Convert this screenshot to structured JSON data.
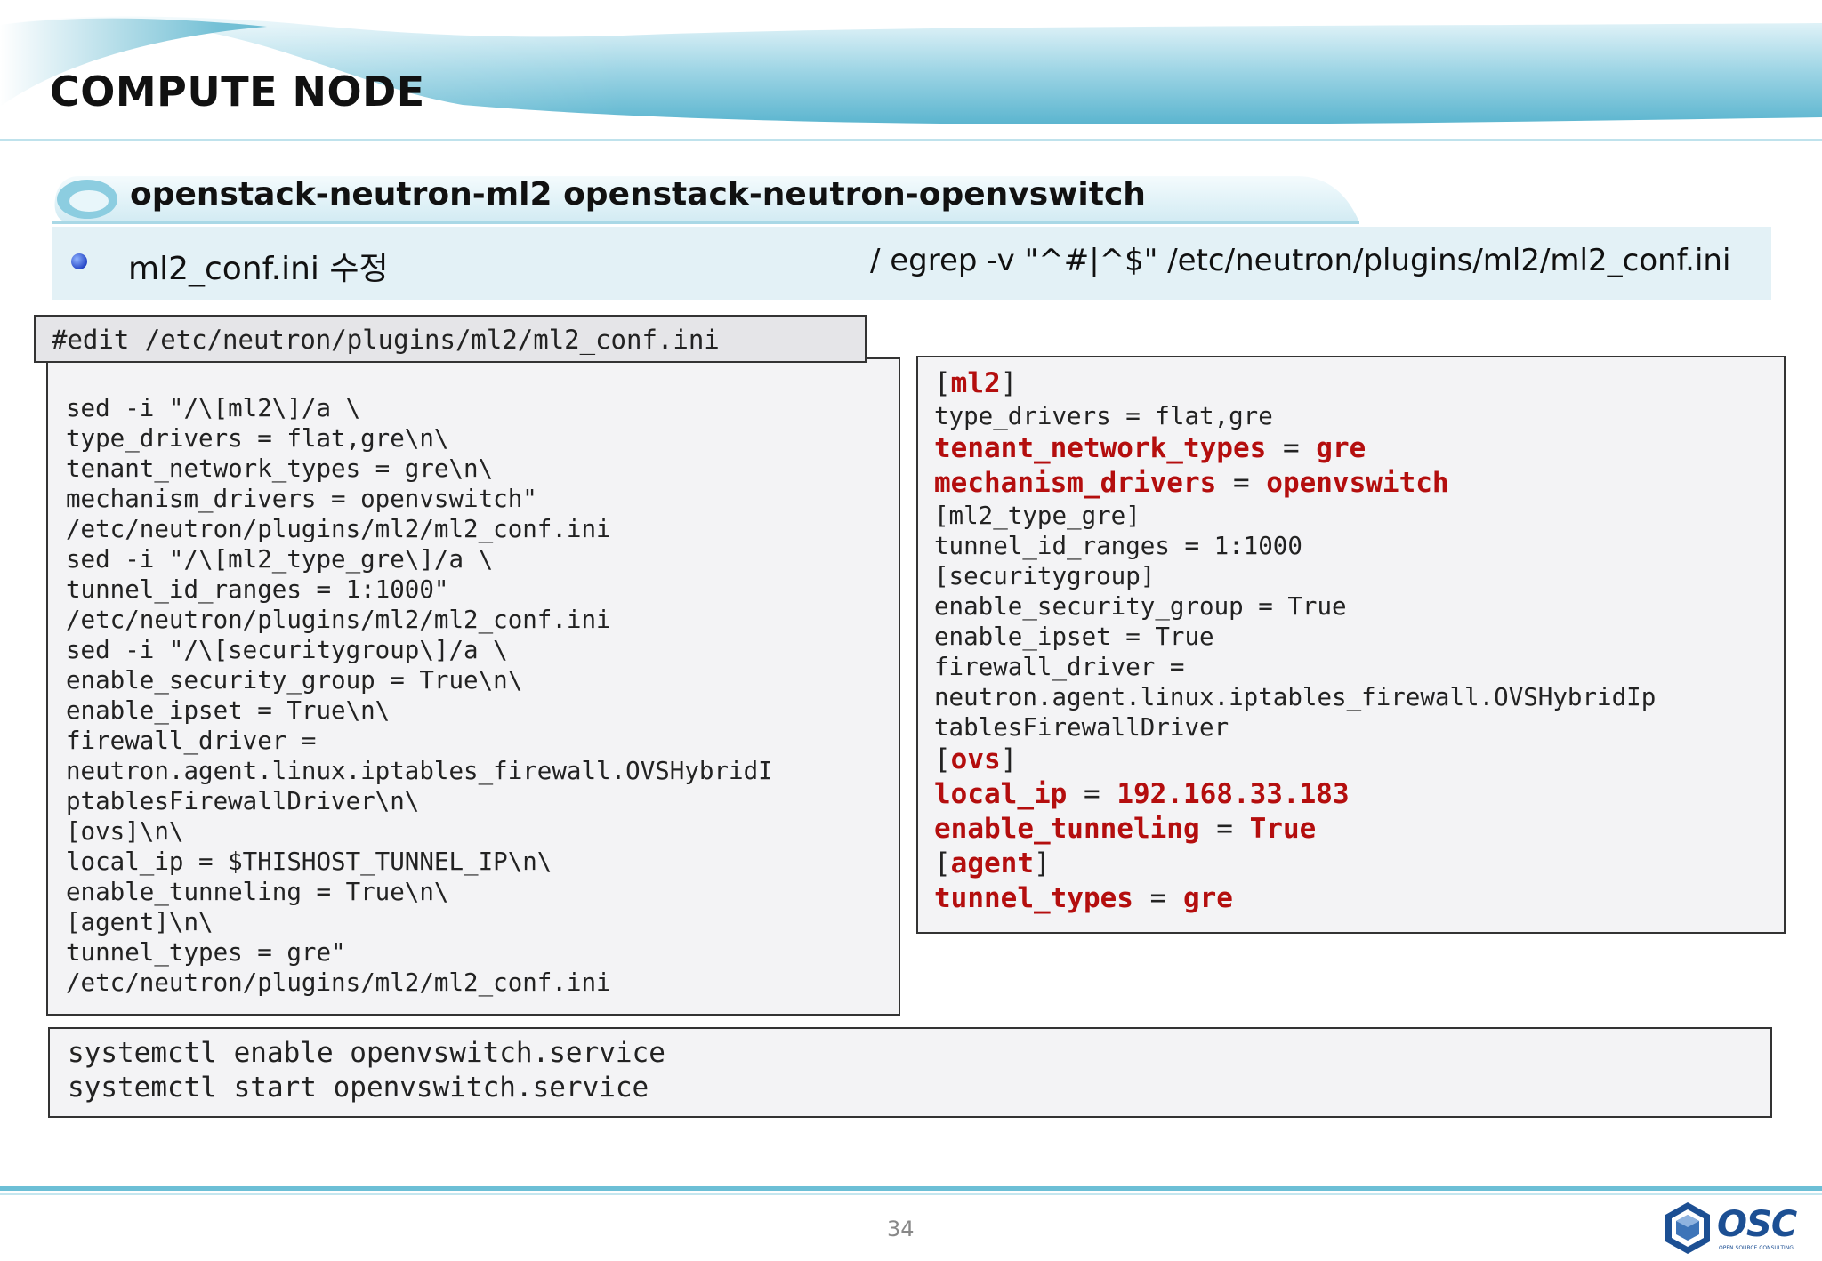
{
  "page": {
    "title": "COMPUTE NODE",
    "subtitle": "openstack-neutron-ml2 openstack-neutron-openvswitch",
    "bullet": {
      "text": "ml2_conf.ini 수정",
      "command": "/ egrep -v \"^#|^$\" /etc/neutron/plugins/ml2/ml2_conf.ini"
    },
    "page_number": "34"
  },
  "edit_label": "#edit /etc/neutron/plugins/ml2/ml2_conf.ini",
  "left_code": "sed -i \"/\\[ml2\\]/a \\\ntype_drivers = flat,gre\\n\\\ntenant_network_types = gre\\n\\\nmechanism_drivers = openvswitch\"\n/etc/neutron/plugins/ml2/ml2_conf.ini\nsed -i \"/\\[ml2_type_gre\\]/a \\\ntunnel_id_ranges = 1:1000\"\n/etc/neutron/plugins/ml2/ml2_conf.ini\nsed -i \"/\\[securitygroup\\]/a \\\nenable_security_group = True\\n\\\nenable_ipset = True\\n\\\nfirewall_driver =\nneutron.agent.linux.iptables_firewall.OVSHybridI\nptablesFirewallDriver\\n\\\n[ovs]\\n\\\nlocal_ip = $THISHOST_TUNNEL_IP\\n\\\nenable_tunneling = True\\n\\\n[agent]\\n\\\ntunnel_types = gre\"\n/etc/neutron/plugins/ml2/ml2_conf.ini",
  "right_code": {
    "l1_open": "[",
    "l1_key": "ml2",
    "l1_close": "]",
    "l2": "type_drivers = flat,gre",
    "l3_key": "tenant_network_types",
    "l3_eq": " = ",
    "l3_val": "gre",
    "l4_key": "mechanism_drivers",
    "l4_eq": " = ",
    "l4_val": "openvswitch",
    "l5": "[ml2_type_gre]",
    "l6": "tunnel_id_ranges = 1:1000",
    "l7": "[securitygroup]",
    "l8": "enable_security_group = True",
    "l9": "enable_ipset = True",
    "l10": "firewall_driver =",
    "l11": "neutron.agent.linux.iptables_firewall.OVSHybridIp",
    "l12": "tablesFirewallDriver",
    "l13_open": "[",
    "l13_key": "ovs",
    "l13_close": "]",
    "l14_key": "local_ip",
    "l14_eq": " = ",
    "l14_val": "192.168.33.183",
    "l15_key": "enable_tunneling",
    "l15_eq": " = ",
    "l15_val": "True",
    "l16_open": "[",
    "l16_key": "agent",
    "l16_close": "]",
    "l17_key": "tunnel_types",
    "l17_eq": " = ",
    "l17_val": "gre"
  },
  "systemctl": "systemctl enable openvswitch.service\nsystemctl start openvswitch.service",
  "logo": {
    "name": "OSC",
    "tagline": "OPEN SOURCE CONSULTING"
  },
  "colors": {
    "highlight": "#b40e0e",
    "header_accent": "#5bb5cf",
    "bullet_bg": "#e3f1f6",
    "logo_blue": "#1c4f93"
  }
}
